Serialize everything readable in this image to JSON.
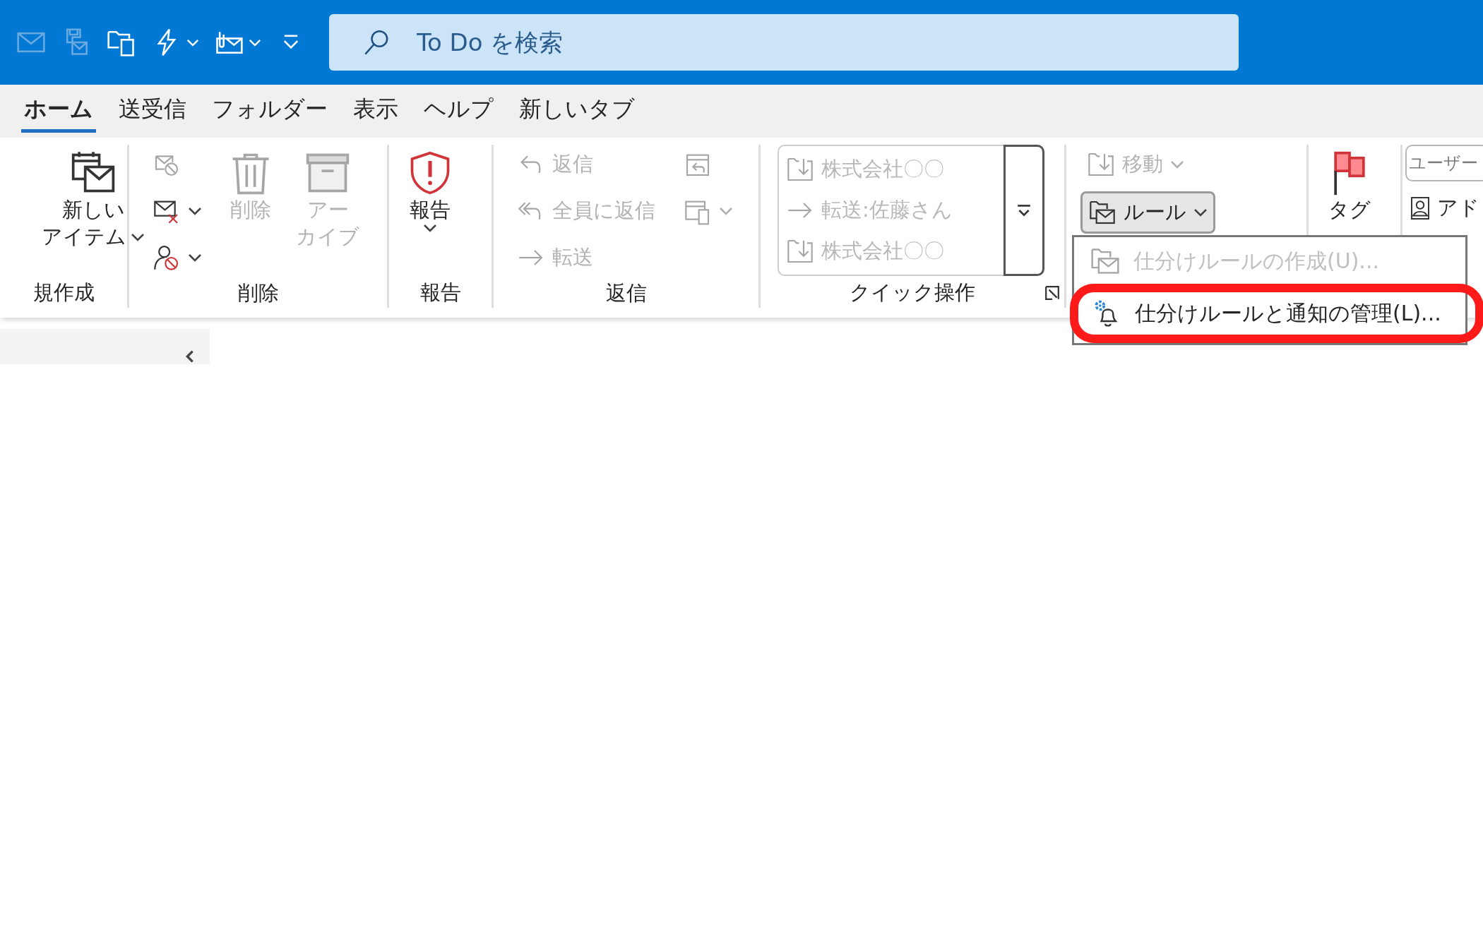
{
  "quick_access": [
    {
      "kind": "mail",
      "disabled": true
    },
    {
      "kind": "save",
      "disabled": true
    },
    {
      "kind": "folders"
    },
    {
      "kind": "lightning",
      "dropdown": true
    },
    {
      "kind": "attach",
      "dropdown": true
    },
    {
      "kind": "customize"
    }
  ],
  "search": {
    "placeholder": "To Do を検索"
  },
  "tabs": [
    {
      "label": "ホーム",
      "selected": true
    },
    {
      "label": "送受信",
      "selected": false
    },
    {
      "label": "フォルダー",
      "selected": false
    },
    {
      "label": "表示",
      "selected": false
    },
    {
      "label": "ヘルプ",
      "selected": false
    },
    {
      "label": "新しいタブ",
      "selected": false
    }
  ],
  "ribbon": {
    "groups": [
      {
        "label": "規作成",
        "columns": [
          [
            {
              "kind": "newitem",
              "lines": [
                "新しい",
                "アイテム"
              ],
              "dropdown": true
            }
          ]
        ]
      },
      {
        "label": "削除",
        "columns": [
          [
            {
              "kind": "ignore",
              "disabled": true
            },
            {
              "kind": "cleanup",
              "dropdown": true
            },
            {
              "kind": "junk",
              "dropdown": true
            }
          ],
          [
            {
              "kind": "trash",
              "lines": [
                "削除"
              ],
              "disabled": true
            }
          ],
          [
            {
              "kind": "archive",
              "lines": [
                "アー",
                "カイブ"
              ],
              "disabled": true
            }
          ]
        ]
      },
      {
        "label": "報告",
        "columns": [
          [
            {
              "kind": "shield",
              "lines": [
                "報告"
              ],
              "dropdown": true
            }
          ]
        ]
      },
      {
        "label": "返信",
        "columns": [
          [
            {
              "kind": "reply",
              "label": "返信",
              "disabled": true
            },
            {
              "kind": "replyall",
              "label": "全員に返信",
              "disabled": true
            },
            {
              "kind": "forward",
              "label": "転送",
              "disabled": true
            }
          ],
          [
            {
              "kind": "meeting",
              "disabled": true
            },
            {
              "kind": "teams",
              "dropdown": true,
              "disabled": true
            }
          ]
        ]
      },
      {
        "label": "クイック操作",
        "quick_steps": [
          {
            "kind": "move",
            "label": "株式会社〇〇",
            "disabled": true
          },
          {
            "kind": "forward",
            "label": "転送:佐藤さん",
            "disabled": true
          },
          {
            "kind": "move",
            "label": "株式会社〇〇",
            "disabled": true
          }
        ]
      },
      {
        "columns": [
          [
            {
              "kind": "move",
              "label": "移動",
              "dropdown": true,
              "disabled": true
            },
            {
              "kind": "rules",
              "label": "ルール",
              "dropdown": true,
              "pressed": true
            }
          ]
        ]
      },
      {
        "columns": [
          [
            {
              "kind": "flag",
              "lines": [
                "タグ"
              ]
            }
          ]
        ]
      },
      {
        "columns": [
          [
            {
              "kind": "field",
              "placeholder": "ユーザー"
            },
            {
              "kind": "contact",
              "label": "アド"
            }
          ]
        ]
      }
    ]
  },
  "menu": {
    "items": [
      {
        "kind": "rules",
        "label": "仕分けルールの作成(U)...",
        "disabled": true
      },
      {
        "kind": "bell",
        "label": "仕分けルールと通知の管理(L)...",
        "annotated": true
      }
    ]
  }
}
